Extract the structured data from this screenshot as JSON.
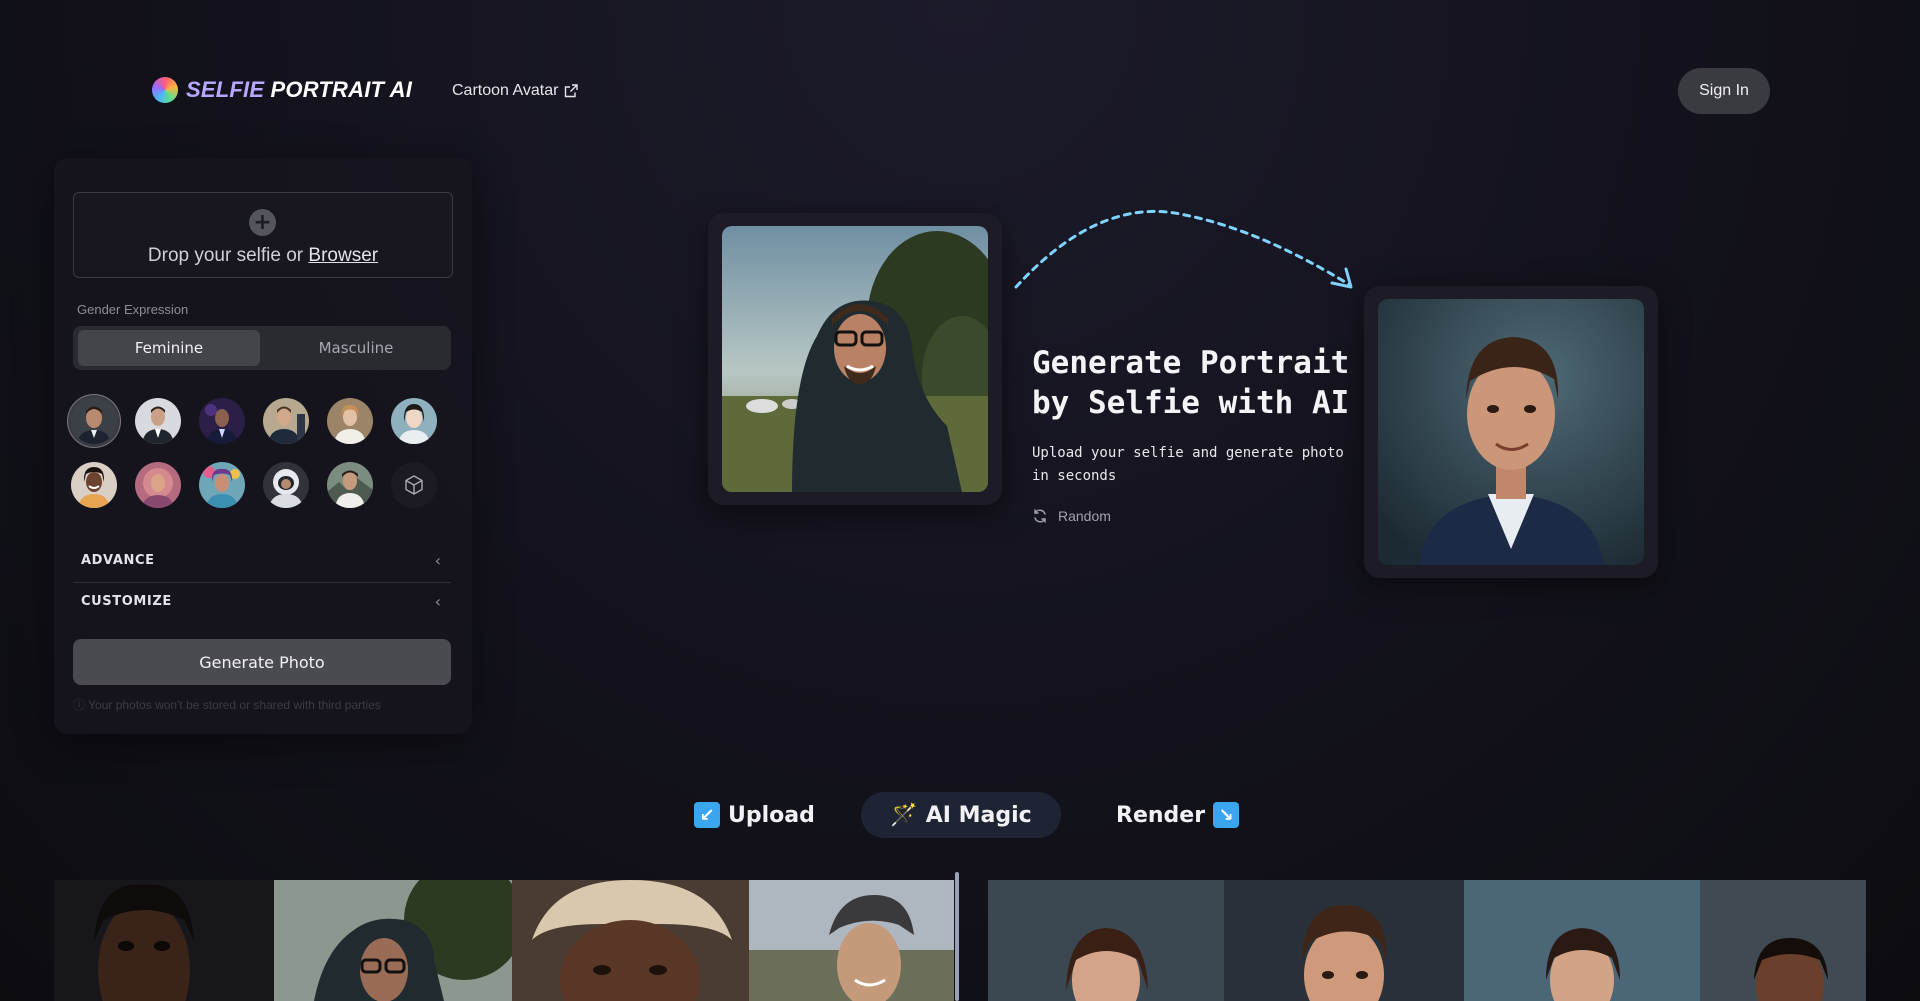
{
  "header": {
    "logo_part1": "SELFIE",
    "logo_part2": "PORTRAIT AI",
    "nav_link": "Cartoon Avatar",
    "sign_in": "Sign In"
  },
  "upload": {
    "drop_text": "Drop your selfie or",
    "browse_link": "Browser"
  },
  "gender": {
    "label": "Gender Expression",
    "options": [
      "Feminine",
      "Masculine"
    ],
    "selected": "Feminine"
  },
  "styles_count": 11,
  "sections": {
    "advance": "ADVANCE",
    "customize": "CUSTOMIZE"
  },
  "generate_button": "Generate Photo",
  "privacy_note": "Your photos won't be stored or shared with third parties",
  "hero": {
    "title": "Generate Portrait by Selfie with AI",
    "subtitle": "Upload your selfie and generate photo in seconds",
    "random_label": "Random"
  },
  "steps": {
    "upload": "Upload",
    "magic": "AI Magic",
    "render": "Render"
  },
  "colors": {
    "background": "#15141f",
    "accent_arrow": "#7fd3ff",
    "button": "#4a4a51"
  }
}
